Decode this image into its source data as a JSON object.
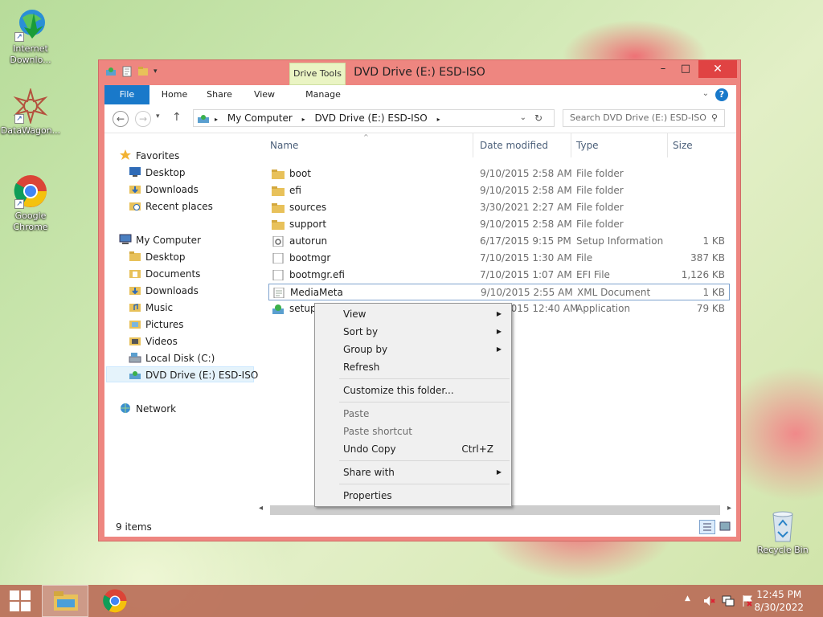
{
  "desktop": {
    "icons": [
      {
        "label": "Internet Downlo..."
      },
      {
        "label": "DataWagon..."
      },
      {
        "label": "Google Chrome"
      },
      {
        "label": "Recycle Bin"
      }
    ]
  },
  "window": {
    "title": "DVD Drive (E:) ESD-ISO",
    "contextual_tab": "Drive Tools",
    "controls": {
      "minimize": "–",
      "maximize": "□",
      "close": "✕"
    },
    "tabs": [
      "File",
      "Home",
      "Share",
      "View",
      "Manage"
    ],
    "address": {
      "segments": [
        "My Computer",
        "DVD Drive (E:) ESD-ISO"
      ]
    },
    "search_placeholder": "Search DVD Drive (E:) ESD-ISO",
    "nav": {
      "favorites": {
        "label": "Favorites",
        "items": [
          "Desktop",
          "Downloads",
          "Recent places"
        ]
      },
      "computer": {
        "label": "My Computer",
        "items": [
          "Desktop",
          "Documents",
          "Downloads",
          "Music",
          "Pictures",
          "Videos",
          "Local Disk (C:)",
          "DVD Drive (E:) ESD-ISO"
        ]
      },
      "network": {
        "label": "Network"
      }
    },
    "columns": {
      "name": "Name",
      "date": "Date modified",
      "type": "Type",
      "size": "Size"
    },
    "files": [
      {
        "name": "boot",
        "date": "9/10/2015 2:58 AM",
        "type": "File folder",
        "size": "",
        "icon": "folder-icon"
      },
      {
        "name": "efi",
        "date": "9/10/2015 2:58 AM",
        "type": "File folder",
        "size": "",
        "icon": "folder-icon"
      },
      {
        "name": "sources",
        "date": "3/30/2021 2:27 AM",
        "type": "File folder",
        "size": "",
        "icon": "folder-icon"
      },
      {
        "name": "support",
        "date": "9/10/2015 2:58 AM",
        "type": "File folder",
        "size": "",
        "icon": "folder-icon"
      },
      {
        "name": "autorun",
        "date": "6/17/2015 9:15 PM",
        "type": "Setup Information",
        "size": "1 KB",
        "icon": "settings-file-icon"
      },
      {
        "name": "bootmgr",
        "date": "7/10/2015 1:30 AM",
        "type": "File",
        "size": "387 KB",
        "icon": "file-icon"
      },
      {
        "name": "bootmgr.efi",
        "date": "7/10/2015 1:07 AM",
        "type": "EFI File",
        "size": "1,126 KB",
        "icon": "file-icon"
      },
      {
        "name": "MediaMeta",
        "date": "9/10/2015 2:55 AM",
        "type": "XML Document",
        "size": "1 KB",
        "icon": "xml-file-icon"
      },
      {
        "name": "setup",
        "date": "7/10/2015 12:40 AM",
        "type": "Application",
        "size": "79 KB",
        "icon": "setup-app-icon"
      }
    ],
    "status": "9 items"
  },
  "context_menu": {
    "items": [
      {
        "label": "View",
        "submenu": true
      },
      {
        "label": "Sort by",
        "submenu": true
      },
      {
        "label": "Group by",
        "submenu": true
      },
      {
        "label": "Refresh"
      },
      {
        "label": "Customize this folder..."
      },
      {
        "label": "Paste",
        "disabled": true
      },
      {
        "label": "Paste shortcut",
        "disabled": true
      },
      {
        "label": "Undo Copy",
        "shortcut": "Ctrl+Z"
      },
      {
        "label": "Share with",
        "submenu": true
      },
      {
        "label": "Properties"
      }
    ]
  },
  "taskbar": {
    "time": "12:45 PM",
    "date": "8/30/2022"
  },
  "colors": {
    "window_frame": "#ee8680",
    "file_tab": "#1979ca",
    "close_button": "#e04343",
    "taskbar": "#ba6e58",
    "folder": "#e8c15a"
  }
}
